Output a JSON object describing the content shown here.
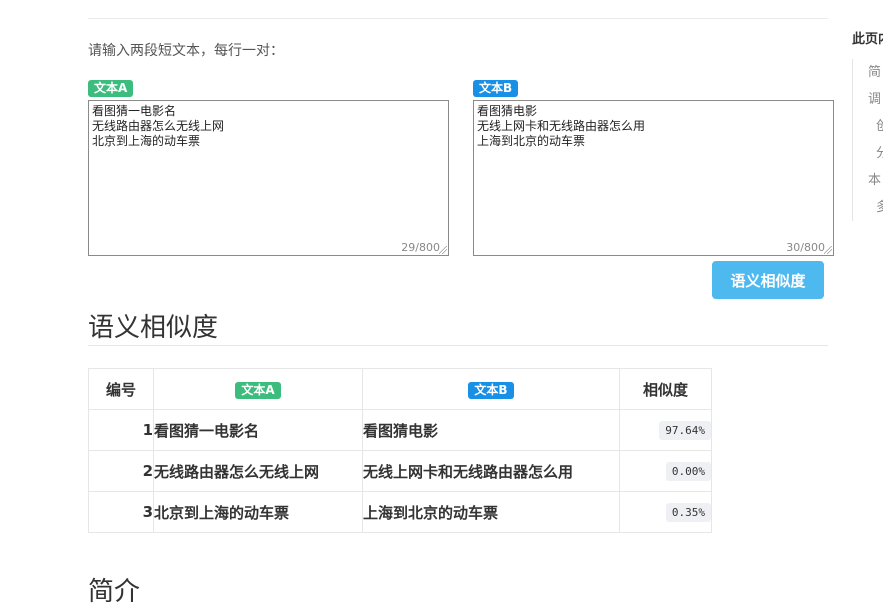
{
  "form": {
    "instruction": "请输入两段短文本，每行一对：",
    "text_a": {
      "label": "文本A",
      "value": "看图猜一电影名\n无线路由器怎么无线上网\n北京到上海的动车票",
      "counter": "29/800"
    },
    "text_b": {
      "label": "文本B",
      "value": "看图猜电影\n无线上网卡和无线路由器怎么用\n上海到北京的动车票",
      "counter": "30/800"
    },
    "submit_label": "语义相似度"
  },
  "results": {
    "title": "语义相似度",
    "headers": [
      "编号",
      "文本A",
      "文本B",
      "相似度"
    ],
    "rows": [
      {
        "id": "1",
        "a": "看图猜一电影名",
        "b": "看图猜电影",
        "score": "97.64%"
      },
      {
        "id": "2",
        "a": "无线路由器怎么无线上网",
        "b": "无线上网卡和无线路由器怎么用",
        "score": "0.00%"
      },
      {
        "id": "3",
        "a": "北京到上海的动车票",
        "b": "上海到北京的动车票",
        "score": "0.35%"
      }
    ]
  },
  "next_section_title": "简介",
  "toc": {
    "title": "此页内",
    "items": [
      "简",
      "调",
      "创",
      "分",
      "本",
      "多"
    ]
  },
  "colors": {
    "tag_a": "#3dbd7d",
    "tag_b": "#1890e6",
    "button": "#4eb9ee"
  }
}
